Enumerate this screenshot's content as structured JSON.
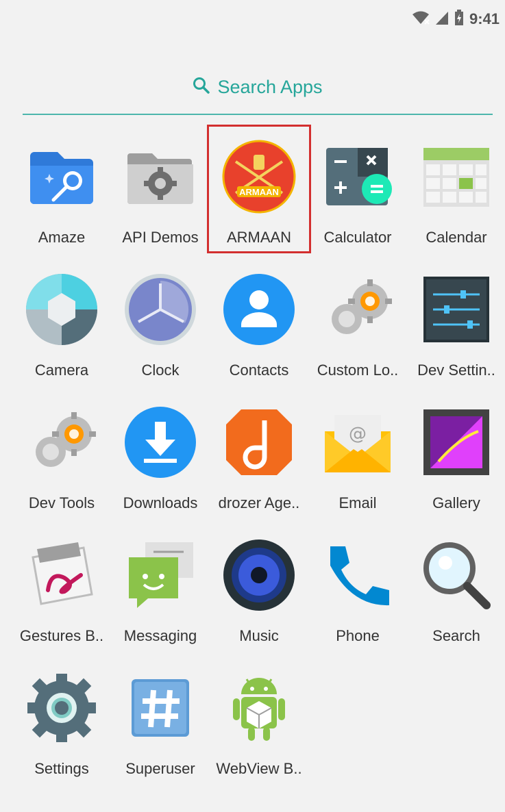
{
  "status_bar": {
    "time": "9:41",
    "icons": [
      "wifi-icon",
      "signal-icon",
      "battery-icon"
    ]
  },
  "search": {
    "label": "Search Apps",
    "icon": "search-icon",
    "accent": "#26a69a"
  },
  "highlight": {
    "app": "ARMAAN",
    "color": "#d32f2f"
  },
  "armaan_badge": "ARMAAN",
  "apps": [
    [
      {
        "label": "Amaze",
        "icon": "amaze-folder-icon"
      },
      {
        "label": "API Demos",
        "icon": "api-demos-folder-icon"
      },
      {
        "label": "ARMAAN",
        "icon": "armaan-emblem-icon"
      },
      {
        "label": "Calculator",
        "icon": "calculator-icon"
      },
      {
        "label": "Calendar",
        "icon": "calendar-icon"
      }
    ],
    [
      {
        "label": "Camera",
        "icon": "camera-shutter-icon"
      },
      {
        "label": "Clock",
        "icon": "clock-icon"
      },
      {
        "label": "Contacts",
        "icon": "contacts-person-icon"
      },
      {
        "label": "Custom Lo..",
        "icon": "custom-locale-gear-icon"
      },
      {
        "label": "Dev Settin..",
        "icon": "dev-settings-sliders-icon"
      }
    ],
    [
      {
        "label": "Dev Tools",
        "icon": "dev-tools-gear-icon"
      },
      {
        "label": "Downloads",
        "icon": "download-arrow-icon"
      },
      {
        "label": "drozer Age..",
        "icon": "drozer-d-icon"
      },
      {
        "label": "Email",
        "icon": "email-envelope-icon"
      },
      {
        "label": "Gallery",
        "icon": "gallery-picture-icon"
      }
    ],
    [
      {
        "label": "Gestures B..",
        "icon": "gestures-icon"
      },
      {
        "label": "Messaging",
        "icon": "messaging-smiley-icon"
      },
      {
        "label": "Music",
        "icon": "music-speaker-icon"
      },
      {
        "label": "Phone",
        "icon": "phone-handset-icon"
      },
      {
        "label": "Search",
        "icon": "magnifier-icon"
      }
    ],
    [
      {
        "label": "Settings",
        "icon": "settings-gear-icon"
      },
      {
        "label": "Superuser",
        "icon": "superuser-hash-icon"
      },
      {
        "label": "WebView B..",
        "icon": "webview-android-icon"
      }
    ]
  ]
}
